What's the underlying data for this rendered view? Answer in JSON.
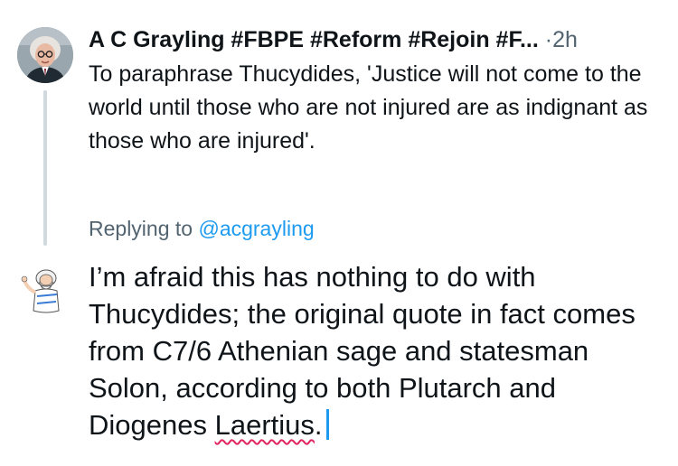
{
  "tweet": {
    "author_name": "A C Grayling #FBPE #Reform #Rejoin #F...",
    "separator": "·",
    "time": "2h",
    "text": "To paraphrase Thucydides, 'Justice will not come to the world until those who are not injured are as indignant as those who are injured'."
  },
  "reply": {
    "replying_prefix": "Replying to",
    "replying_handle": "@acgrayling",
    "draft_text": "I’m afraid this has nothing to do with Thucydides; the original quote in fact comes from C7/6 Athenian sage and statesman Solon, according to both Plutarch and Diogenes",
    "misspelled_word": "Laertius",
    "trailing": "."
  },
  "colors": {
    "accent": "#1d9bf0",
    "secondary_text": "#536471",
    "thread_line": "#cfd9de",
    "spellcheck": "#e0245e"
  },
  "icons": {
    "author_avatar": "profile-photo",
    "reply_avatar": "cartoon-sage-avatar"
  }
}
